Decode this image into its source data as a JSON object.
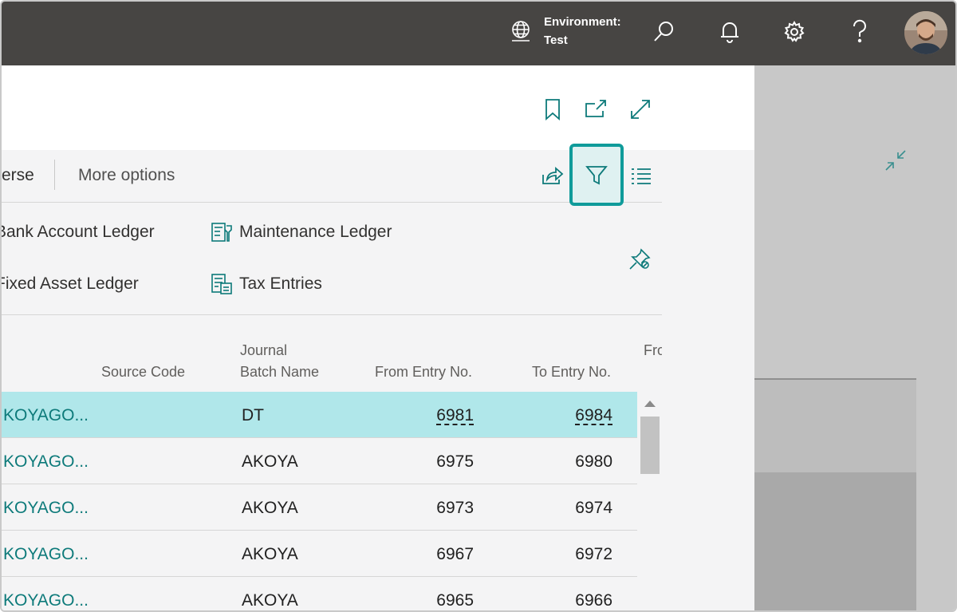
{
  "topbar": {
    "environment_label": "Environment:",
    "environment_value": "Test",
    "icons": [
      "globe-icon",
      "search-icon",
      "bell-icon",
      "gear-icon",
      "help-icon"
    ]
  },
  "actions": {
    "reverse_partial": "erse",
    "more_options": "More options"
  },
  "navigate": {
    "bank_account_ledger": "Bank Account Ledger",
    "maintenance_ledger": "Maintenance Ledger",
    "fixed_asset_ledger": "Fixed Asset Ledger",
    "tax_entries": "Tax Entries"
  },
  "table": {
    "headers": {
      "source_code": "Source Code",
      "journal_batch_line1": "Journal",
      "journal_batch_line2": "Batch Name",
      "from_entry": "From Entry No.",
      "to_entry": "To Entry No.",
      "from_partial": "Fro"
    },
    "rows": [
      {
        "user": "KOYAGO...",
        "batch": "DT",
        "from": "6981",
        "to": "6984",
        "selected": true
      },
      {
        "user": "KOYAGO...",
        "batch": "AKOYA",
        "from": "6975",
        "to": "6980",
        "selected": false
      },
      {
        "user": "KOYAGO...",
        "batch": "AKOYA",
        "from": "6973",
        "to": "6974",
        "selected": false
      },
      {
        "user": "KOYAGO...",
        "batch": "AKOYA",
        "from": "6967",
        "to": "6972",
        "selected": false
      },
      {
        "user": "KOYAGO...",
        "batch": "AKOYA",
        "from": "6965",
        "to": "6966",
        "selected": false
      }
    ]
  },
  "colors": {
    "topbar": "#474543",
    "accent": "#0f9b9a",
    "selected_row": "#b0e7ea",
    "link": "#0d7a7a"
  }
}
